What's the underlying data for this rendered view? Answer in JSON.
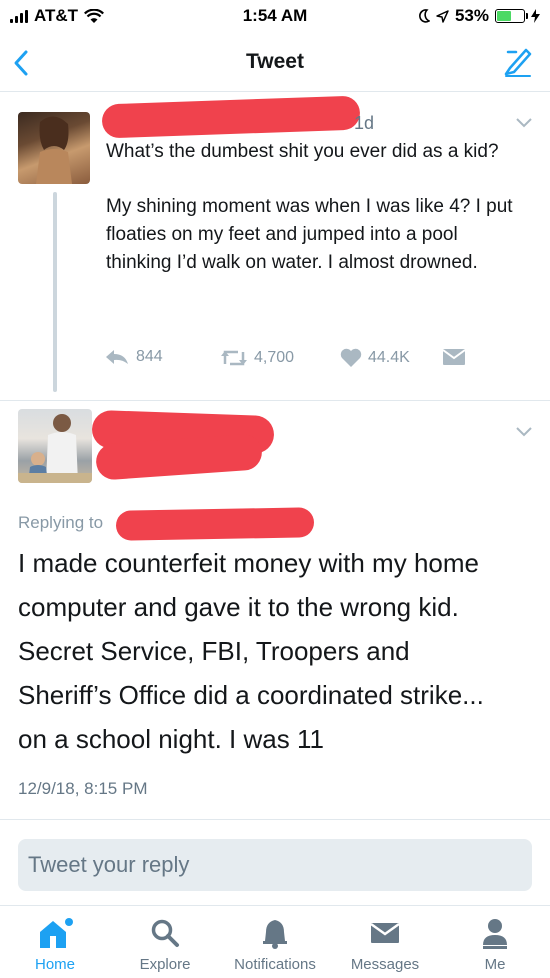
{
  "status": {
    "carrier": "AT&T",
    "time": "1:54 AM",
    "battery": "53%",
    "battery_level": 0.53
  },
  "nav": {
    "title": "Tweet"
  },
  "tweet1": {
    "time": "1d",
    "text1": "What’s the dumbest shit you ever did as a kid?",
    "text2": "My shining moment was when I was like 4? I put floaties on my feet and jumped into a pool thinking I’d walk on water. I almost drowned.",
    "replies": "844",
    "retweets": "4,700",
    "likes": "44.4K"
  },
  "tweet2": {
    "replying": "Replying to",
    "lines": [
      "I made counterfeit money with my home",
      "computer and gave it to the wrong kid.",
      "Secret Service, FBI, Troopers and",
      "Sheriff’s Office did a coordinated strike...",
      "on a school night. I was 11"
    ],
    "date": "12/9/18, 8:15 PM"
  },
  "reply": {
    "placeholder": "Tweet your reply"
  },
  "tabs": [
    "Home",
    "Explore",
    "Notifications",
    "Messages",
    "Me"
  ],
  "colors": {
    "accent": "#1da1f2",
    "redaction": "#f0424d",
    "muted": "#8899a6"
  }
}
